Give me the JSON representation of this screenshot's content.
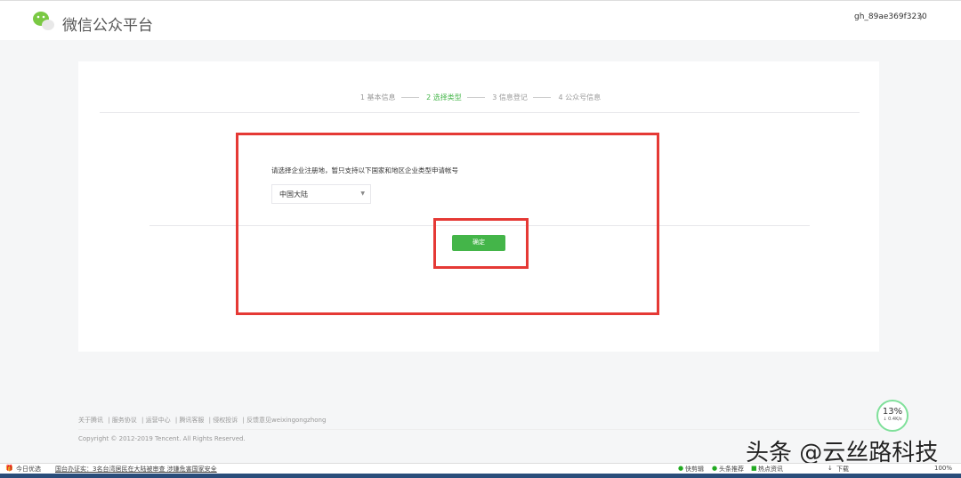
{
  "header": {
    "brand": "微信公众平台",
    "account": "gh_89ae369f3230"
  },
  "steps": [
    {
      "label": "1 基本信息"
    },
    {
      "label": "2 选择类型"
    },
    {
      "label": "3 信息登记"
    },
    {
      "label": "4 公众号信息"
    }
  ],
  "form": {
    "prompt": "请选择企业注册地，暂只支持以下国家和地区企业类型申请帐号",
    "region": "中国大陆",
    "confirm": "确定"
  },
  "footer": {
    "links": [
      "关于腾讯",
      "服务协议",
      "运营中心",
      "腾讯客服",
      "侵权投诉",
      "反馈意见weixingongzhong"
    ],
    "copyright": "Copyright © 2012-2019 Tencent. All Rights Reserved."
  },
  "progress": {
    "percent": "13%",
    "speed": "↓ 0.4K/s"
  },
  "watermark": "头条 @云丝路科技",
  "statusbar": {
    "left": "今日优选",
    "news": "国台办证实：3名台湾居民在大陆被审查 涉嫌危害国家安全",
    "items": [
      "快剪辑",
      "头条推荐",
      "热点资讯",
      "下载",
      "100%"
    ]
  },
  "colors": {
    "accent": "#44b549",
    "highlight": "#e53935"
  }
}
